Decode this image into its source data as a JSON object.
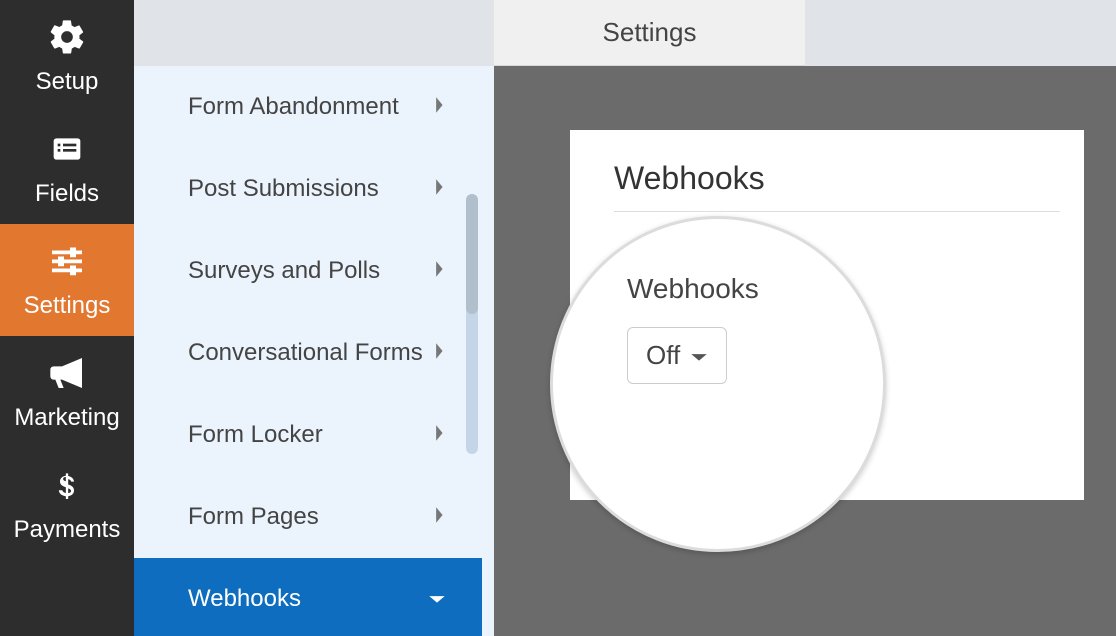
{
  "nav": {
    "items": [
      {
        "id": "setup",
        "label": "Setup",
        "icon": "gear-icon"
      },
      {
        "id": "fields",
        "label": "Fields",
        "icon": "list-icon"
      },
      {
        "id": "settings",
        "label": "Settings",
        "icon": "sliders-icon",
        "active": true
      },
      {
        "id": "marketing",
        "label": "Marketing",
        "icon": "megaphone-icon"
      },
      {
        "id": "payments",
        "label": "Payments",
        "icon": "dollar-icon"
      }
    ]
  },
  "topbar": {
    "tabs": [
      {
        "label": "Settings",
        "active": true
      },
      {
        "label": "",
        "active": false
      }
    ]
  },
  "settings_menu": {
    "items": [
      {
        "label": "Form Abandonment"
      },
      {
        "label": "Post Submissions"
      },
      {
        "label": "Surveys and Polls"
      },
      {
        "label": "Conversational Forms"
      },
      {
        "label": "Form Locker"
      },
      {
        "label": "Form Pages"
      },
      {
        "label": "Webhooks",
        "active": true
      }
    ]
  },
  "panel": {
    "title": "Webhooks",
    "field_label": "Webhooks",
    "dropdown_value": "Off"
  }
}
